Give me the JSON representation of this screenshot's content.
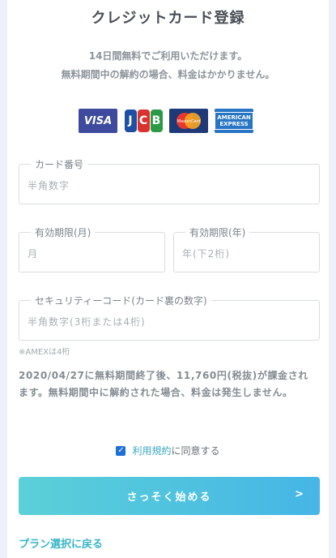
{
  "form": {
    "title": "クレジットカード登録",
    "subtitle_line1": "14日間無料でご利用いただけます。",
    "subtitle_line2": "無料期間中の解約の場合、料金はかかりません。"
  },
  "brands": [
    {
      "name": "visa-logo",
      "label": "VISA"
    },
    {
      "name": "jcb-logo",
      "label": "JCB"
    },
    {
      "name": "mastercard-logo",
      "label": "MasterCard"
    },
    {
      "name": "amex-logo",
      "label": "AMERICAN EXPRESS"
    }
  ],
  "fields": {
    "card_number": {
      "label": "カード番号",
      "placeholder": "半角数字"
    },
    "expiry_month": {
      "label": "有効期限(月)",
      "placeholder": "月"
    },
    "expiry_year": {
      "label": "有効期限(年)",
      "placeholder": "年(下2桁)"
    },
    "security_code": {
      "label": "セキュリティーコード(カード裏の数字)",
      "placeholder": "半角数字(3桁または4桁)"
    }
  },
  "amex_note": "※AMEXは4桁",
  "notice": "2020/04/27に無料期間終了後、11,760円(税抜)が課金されます。無料期間中に解約された場合、料金は発生しません。",
  "agreement": {
    "checked": true,
    "link": "利用規約",
    "text": "に同意する"
  },
  "start_button": {
    "label": "さっそく始める",
    "arrow": ">"
  },
  "back_link": "プラン選択に戻る"
}
